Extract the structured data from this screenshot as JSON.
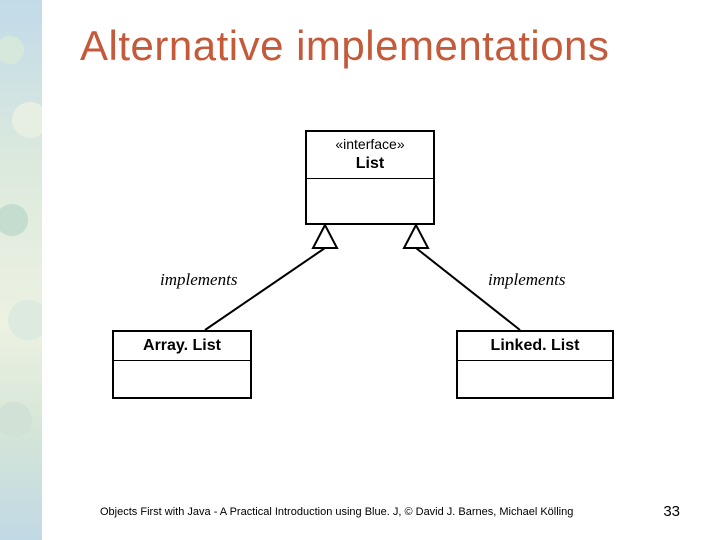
{
  "title": "Alternative implementations",
  "interface_stereotype": "«interface»",
  "interface_name": "List",
  "class_left": "Array. List",
  "class_right": "Linked. List",
  "label_left": "implements",
  "label_right": "implements",
  "footer": "Objects First with Java - A Practical Introduction using Blue. J, © David J. Barnes, Michael Kölling",
  "page_number": "33"
}
